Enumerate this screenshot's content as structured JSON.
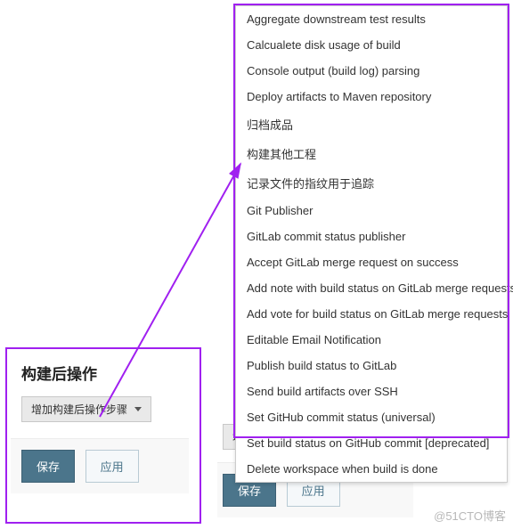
{
  "menu": {
    "items": [
      "Aggregate downstream test results",
      "Calcualete disk usage of build",
      "Console output (build log) parsing",
      "Deploy artifacts to Maven repository",
      "归档成品",
      "构建其他工程",
      "记录文件的指纹用于追踪",
      "Git Publisher",
      "GitLab commit status publisher",
      "Accept GitLab merge request on success",
      "Add note with build status on GitLab merge requests",
      "Add vote for build status on GitLab merge requests",
      "Editable Email Notification",
      "Publish build status to GitLab",
      "Send build artifacts over SSH",
      "Set GitHub commit status (universal)",
      "Set build status on GitHub commit [deprecated]",
      "Delete workspace when build is done"
    ]
  },
  "section": {
    "title": "构建后操作",
    "add_button": "增加构建后操作步骤"
  },
  "buttons": {
    "save": "保存",
    "apply": "应用"
  },
  "watermark": "@51CTO博客"
}
